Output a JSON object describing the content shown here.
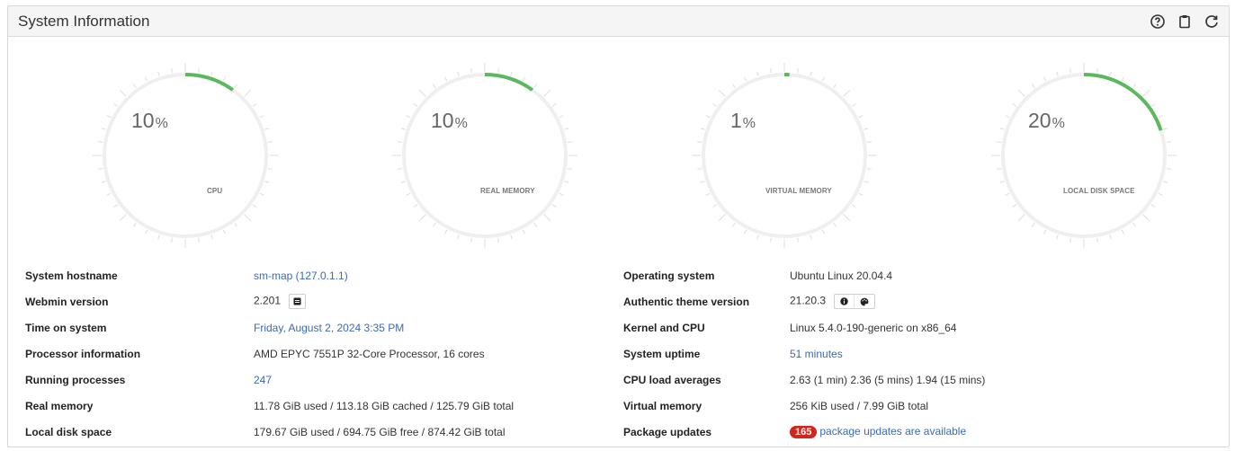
{
  "header": {
    "title": "System Information"
  },
  "gauges": [
    {
      "label": "CPU",
      "value": 10,
      "unit": "%"
    },
    {
      "label": "REAL MEMORY",
      "value": 10,
      "unit": "%"
    },
    {
      "label": "VIRTUAL MEMORY",
      "value": 1,
      "unit": "%"
    },
    {
      "label": "LOCAL DISK SPACE",
      "value": 20,
      "unit": "%"
    }
  ],
  "colors": {
    "gauge_fill": "#5cb85c",
    "gauge_track": "#efefef",
    "link": "#3b6bb3",
    "badge": "#d0261c"
  },
  "left_info": {
    "hostname_label": "System hostname",
    "hostname_value": "sm-map (127.0.1.1)",
    "webmin_label": "Webmin version",
    "webmin_value": "2.201",
    "time_label": "Time on system",
    "time_value": "Friday, August 2, 2024 3:35 PM",
    "processor_label": "Processor information",
    "processor_value": "AMD EPYC 7551P 32-Core Processor, 16 cores",
    "processes_label": "Running processes",
    "processes_value": "247",
    "realmem_label": "Real memory",
    "realmem_value": "11.78 GiB used / 113.18 GiB cached / 125.79 GiB total",
    "disk_label": "Local disk space",
    "disk_value": "179.67 GiB used / 694.75 GiB free / 874.42 GiB total"
  },
  "right_info": {
    "os_label": "Operating system",
    "os_value": "Ubuntu Linux 20.04.4",
    "theme_label": "Authentic theme version",
    "theme_value": "21.20.3",
    "kernel_label": "Kernel and CPU",
    "kernel_value": "Linux 5.4.0-190-generic on x86_64",
    "uptime_label": "System uptime",
    "uptime_value": "51 minutes",
    "load_label": "CPU load averages",
    "load_value": "2.63 (1 min) 2.36 (5 mins) 1.94 (15 mins)",
    "vmem_label": "Virtual memory",
    "vmem_value": "256 KiB used / 7.99 GiB total",
    "updates_label": "Package updates",
    "updates_count": "165",
    "updates_text": "package updates are available"
  },
  "icons": {
    "header": [
      "help-icon",
      "clipboard-icon",
      "refresh-icon"
    ],
    "webmin_button": "server-icon",
    "theme_buttons": [
      "info-icon",
      "palette-icon"
    ]
  }
}
